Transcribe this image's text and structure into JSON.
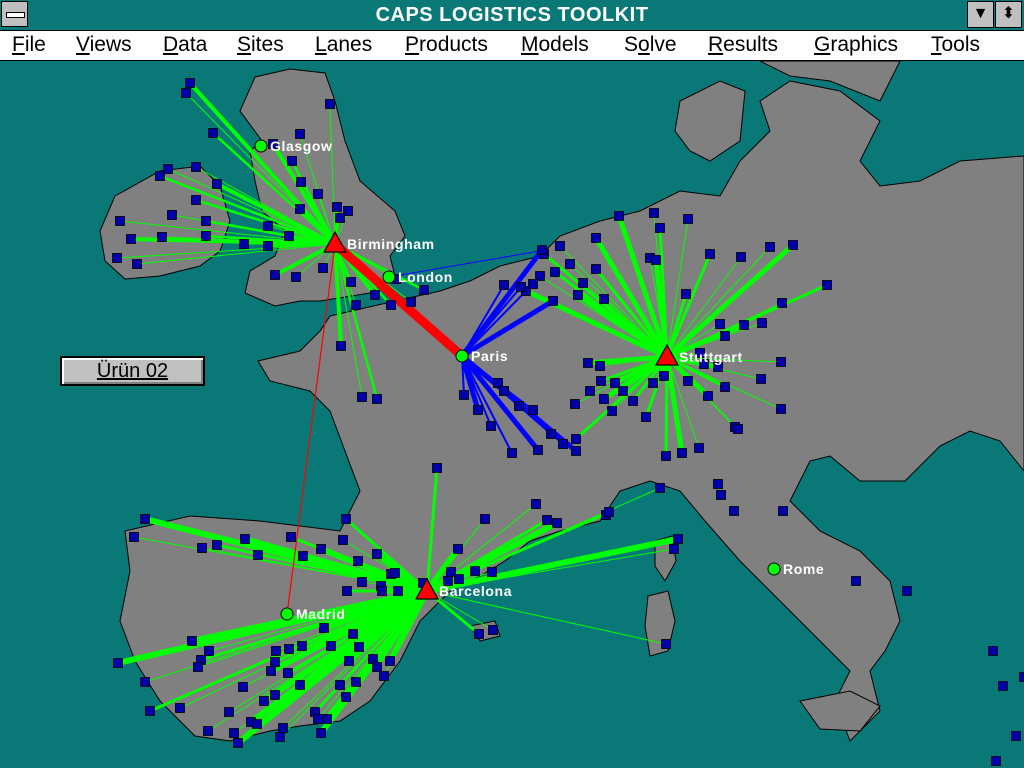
{
  "window": {
    "title": "CAPS LOGISTICS TOOLKIT",
    "minimize_glyph": "▼",
    "restore_glyph": "⬍"
  },
  "menu": [
    {
      "label": "File",
      "accel": "F",
      "rest": "ile"
    },
    {
      "label": "Views",
      "accel": "V",
      "rest": "iews"
    },
    {
      "label": "Data",
      "accel": "D",
      "rest": "ata"
    },
    {
      "label": "Sites",
      "accel": "S",
      "rest": "ites"
    },
    {
      "label": "Lanes",
      "accel": "L",
      "rest": "anes"
    },
    {
      "label": "Products",
      "accel": "P",
      "rest": "roducts"
    },
    {
      "label": "Models",
      "accel": "M",
      "rest": "odels"
    },
    {
      "label": "Solve",
      "pre": "S",
      "accel": "o",
      "rest": "lve"
    },
    {
      "label": "Results",
      "accel": "R",
      "rest": "esults"
    },
    {
      "label": "Graphics",
      "accel": "G",
      "rest": "raphics"
    },
    {
      "label": "Tools",
      "accel": "T",
      "rest": "ools"
    }
  ],
  "product_button": "Ürün 02",
  "map": {
    "sea_color": "#0b7878",
    "land_color": "#808080",
    "facilities": [
      "Birmingham",
      "Stuttgart",
      "Barcelona"
    ],
    "cities": [
      "Glasgow",
      "London",
      "Paris",
      "Madrid",
      "Rome"
    ],
    "facility_color": "#ff0000",
    "city_color": "#00ff00",
    "customer_color": "#0000aa",
    "lane_colors": {
      "customer": "#00ff00",
      "trunk": "#ff0000",
      "paris_lane": "#0000ff"
    }
  }
}
